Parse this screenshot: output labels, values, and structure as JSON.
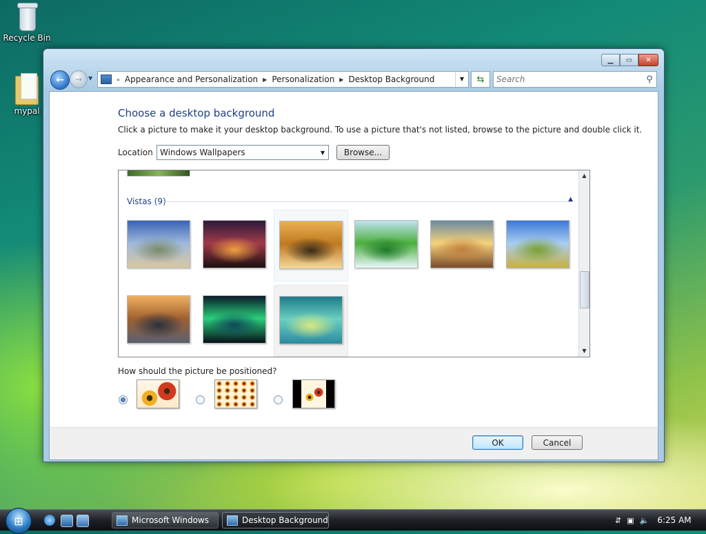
{
  "desktop": {
    "icons": [
      {
        "label": "Recycle Bin"
      },
      {
        "label": "mypal"
      }
    ]
  },
  "window": {
    "address": {
      "crumbs": [
        "Appearance and Personalization",
        "Personalization",
        "Desktop Background"
      ]
    },
    "search": {
      "placeholder": "Search"
    },
    "heading": "Choose a desktop background",
    "description": "Click a picture to make it your desktop background. To use a picture that's not listed, browse to the picture and double click it.",
    "location": {
      "label": "Location",
      "value": "Windows Wallpapers",
      "browse_label": "Browse..."
    },
    "gallery": {
      "group_title": "Vistas (9)",
      "thumbnails": [
        {
          "name": "mountain-lake",
          "colors": [
            "#3a63b5",
            "#9fb9dc",
            "#7a8a6a",
            "#d9c7a0"
          ]
        },
        {
          "name": "sunset-hills",
          "colors": [
            "#2a1a3a",
            "#a23a4a",
            "#f0a040",
            "#1a1010"
          ]
        },
        {
          "name": "golden-rocks",
          "colors": [
            "#e8b050",
            "#c07a20",
            "#3a2a18",
            "#f5d89a"
          ]
        },
        {
          "name": "green-leaf",
          "colors": [
            "#bfe3f0",
            "#4caf3c",
            "#1e7a2a",
            "#e8f6fa"
          ]
        },
        {
          "name": "sunlit-field",
          "colors": [
            "#6a8aa0",
            "#f6d27a",
            "#c08040",
            "#7a4a28"
          ]
        },
        {
          "name": "green-hills",
          "colors": [
            "#3a78d8",
            "#a9cdf0",
            "#7aa030",
            "#c8b040"
          ]
        },
        {
          "name": "rock-reflection",
          "colors": [
            "#f0b060",
            "#a06030",
            "#2a3040",
            "#5a6070"
          ]
        },
        {
          "name": "aurora",
          "colors": [
            "#0a1a2a",
            "#2ad07a",
            "#0e4a5a",
            "#08101a"
          ]
        },
        {
          "name": "vista-aurora",
          "colors": [
            "#1e7a8a",
            "#6ad0c0",
            "#d8e880",
            "#2a8aa0"
          ]
        }
      ]
    },
    "position": {
      "question": "How should the picture be positioned?",
      "selected": 0
    },
    "buttons": {
      "ok": "OK",
      "cancel": "Cancel"
    }
  },
  "taskbar": {
    "tasks": [
      {
        "label": "Microsoft Windows"
      },
      {
        "label": "Desktop Background"
      }
    ],
    "clock": "6:25 AM"
  }
}
